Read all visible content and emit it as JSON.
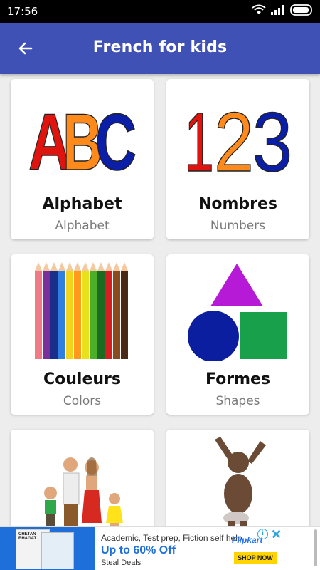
{
  "status_bar": {
    "time": "17:56"
  },
  "app_bar": {
    "title": "French for kids"
  },
  "cards": [
    {
      "title": "Alphabet",
      "subtitle": "Alphabet",
      "icon": "abc-letters-icon"
    },
    {
      "title": "Nombres",
      "subtitle": "Numbers",
      "icon": "numbers-123-icon"
    },
    {
      "title": "Couleurs",
      "subtitle": "Colors",
      "icon": "colored-pencils-icon"
    },
    {
      "title": "Formes",
      "subtitle": "Shapes",
      "icon": "shapes-icon"
    },
    {
      "title": "",
      "subtitle": "",
      "icon": "family-icon"
    },
    {
      "title": "",
      "subtitle": "",
      "icon": "body-baby-icon"
    }
  ],
  "ad": {
    "headline": "Academic, Test prep, Fiction self help...",
    "offer": "Up to 60% Off",
    "subtext": "Steal Deals",
    "brand": "Flipkart",
    "cta": "SHOP NOW",
    "book_title": "CHETAN BHAGAT"
  },
  "colors": {
    "app_bar": "#3f51b5",
    "ad_blue": "#1e6fd9"
  }
}
